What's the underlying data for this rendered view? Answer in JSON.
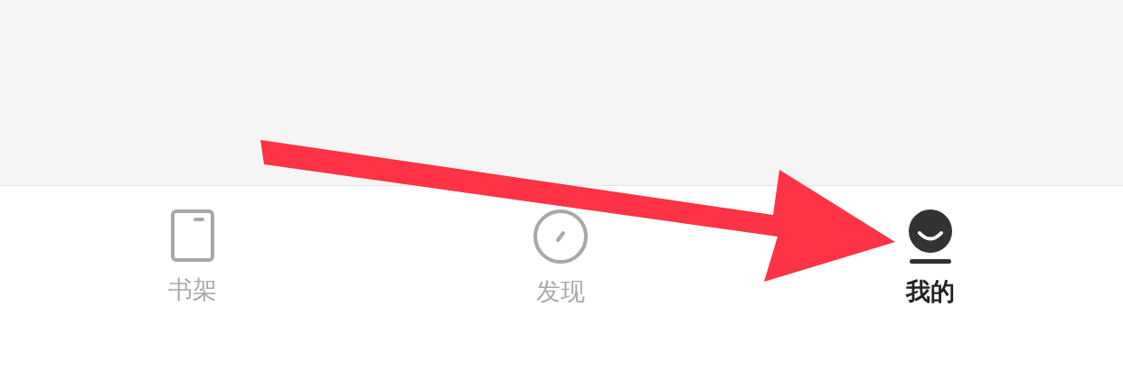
{
  "tab_bar": {
    "tabs": [
      {
        "kind": "book",
        "label": "书架",
        "selected": false
      },
      {
        "kind": "compass",
        "label": "发现",
        "selected": false
      },
      {
        "kind": "profile",
        "label": "我的",
        "selected": true
      }
    ]
  }
}
